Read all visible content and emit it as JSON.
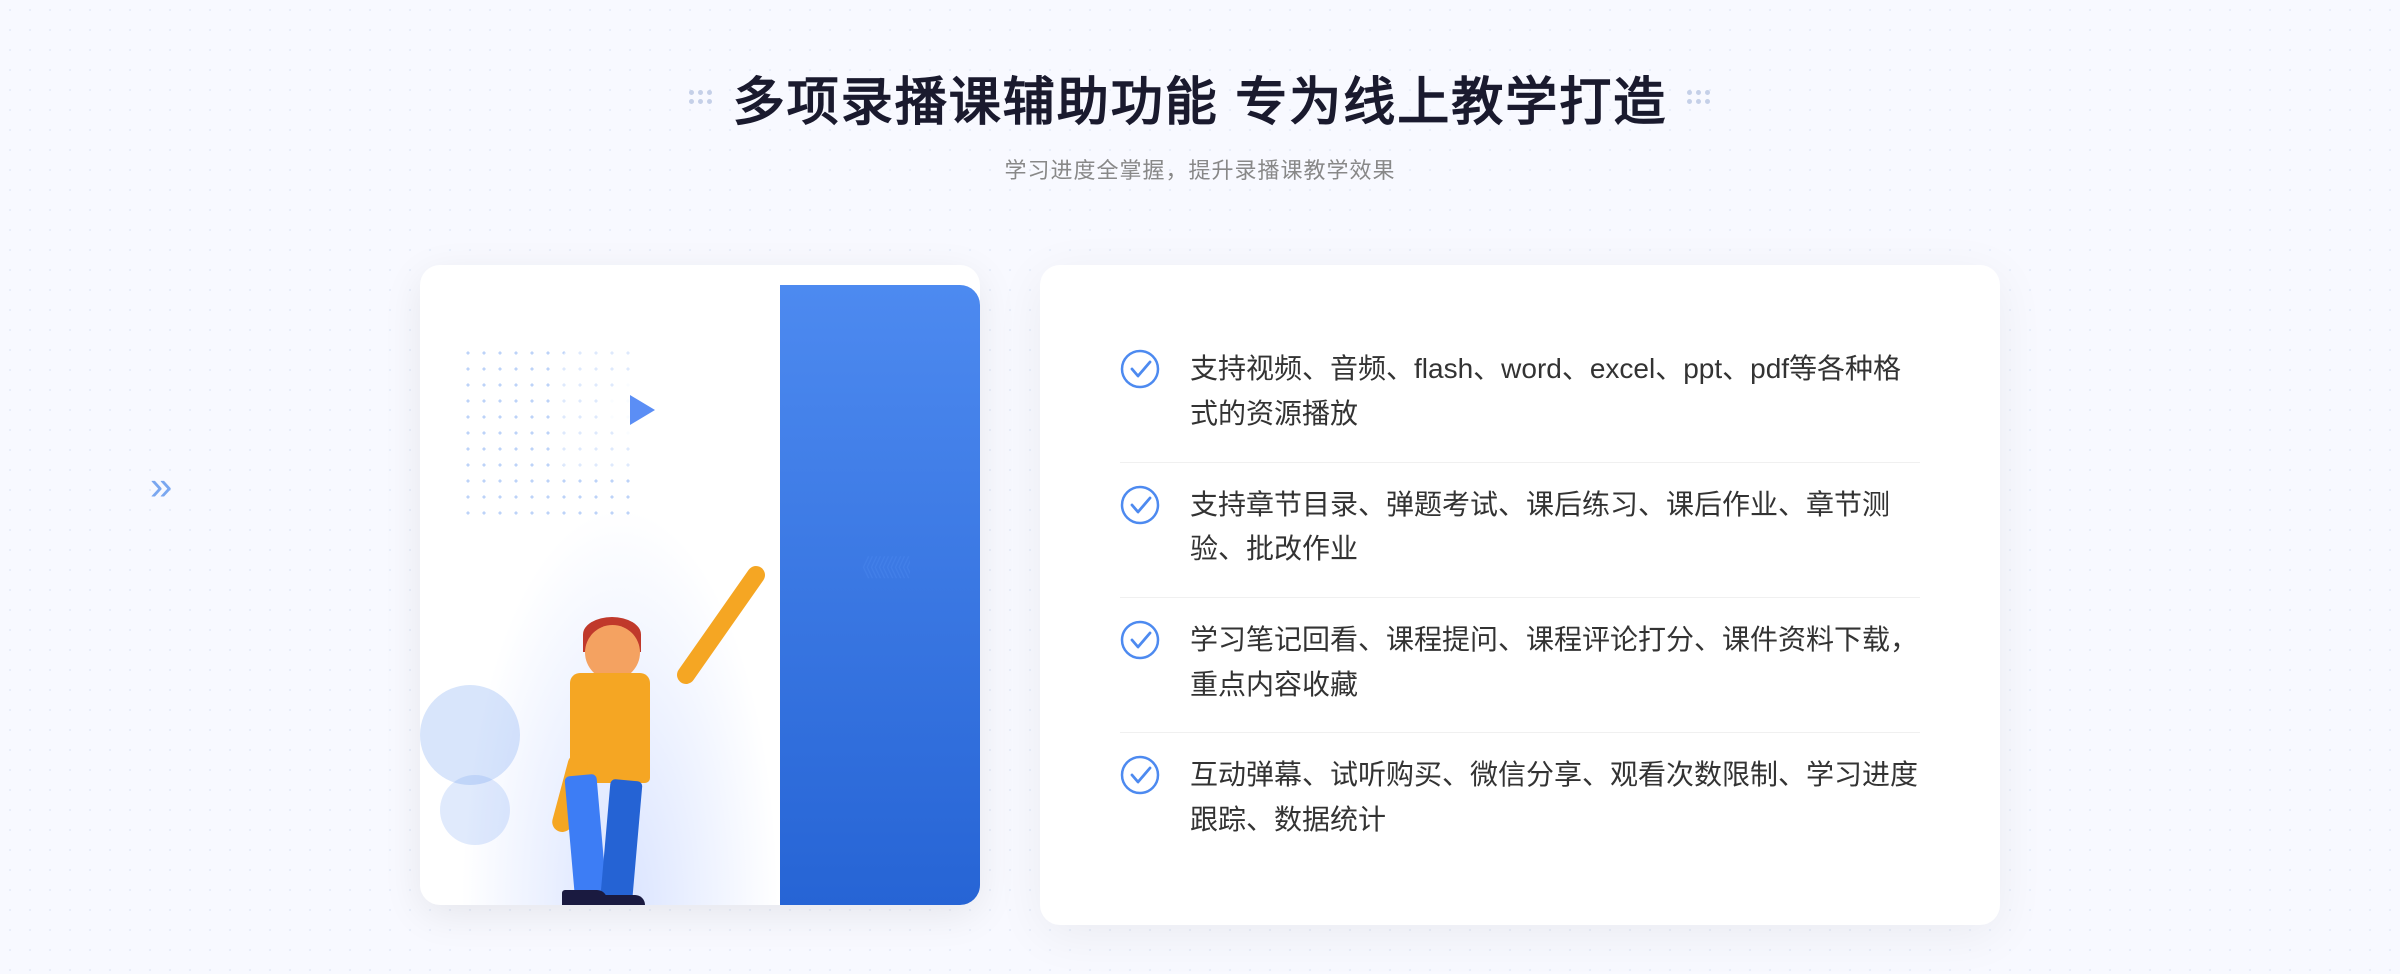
{
  "header": {
    "title": "多项录播课辅助功能 专为线上教学打造",
    "subtitle": "学习进度全掌握，提升录播课教学效果",
    "left_dots_label": "decorative-dots-left",
    "right_dots_label": "decorative-dots-right"
  },
  "features": [
    {
      "id": 1,
      "text": "支持视频、音频、flash、word、excel、ppt、pdf等各种格式的资源播放"
    },
    {
      "id": 2,
      "text": "支持章节目录、弹题考试、课后练习、课后作业、章节测验、批改作业"
    },
    {
      "id": 3,
      "text": "学习笔记回看、课程提问、课程评论打分、课件资料下载，重点内容收藏"
    },
    {
      "id": 4,
      "text": "互动弹幕、试听购买、微信分享、观看次数限制、学习进度跟踪、数据统计"
    }
  ],
  "illustration": {
    "play_button_label": "play-button",
    "person_label": "person-illustration"
  },
  "colors": {
    "blue_primary": "#4d8af0",
    "blue_dark": "#2563d4",
    "text_dark": "#1a1a2e",
    "text_light": "#888888",
    "check_color": "#4d8af0"
  }
}
